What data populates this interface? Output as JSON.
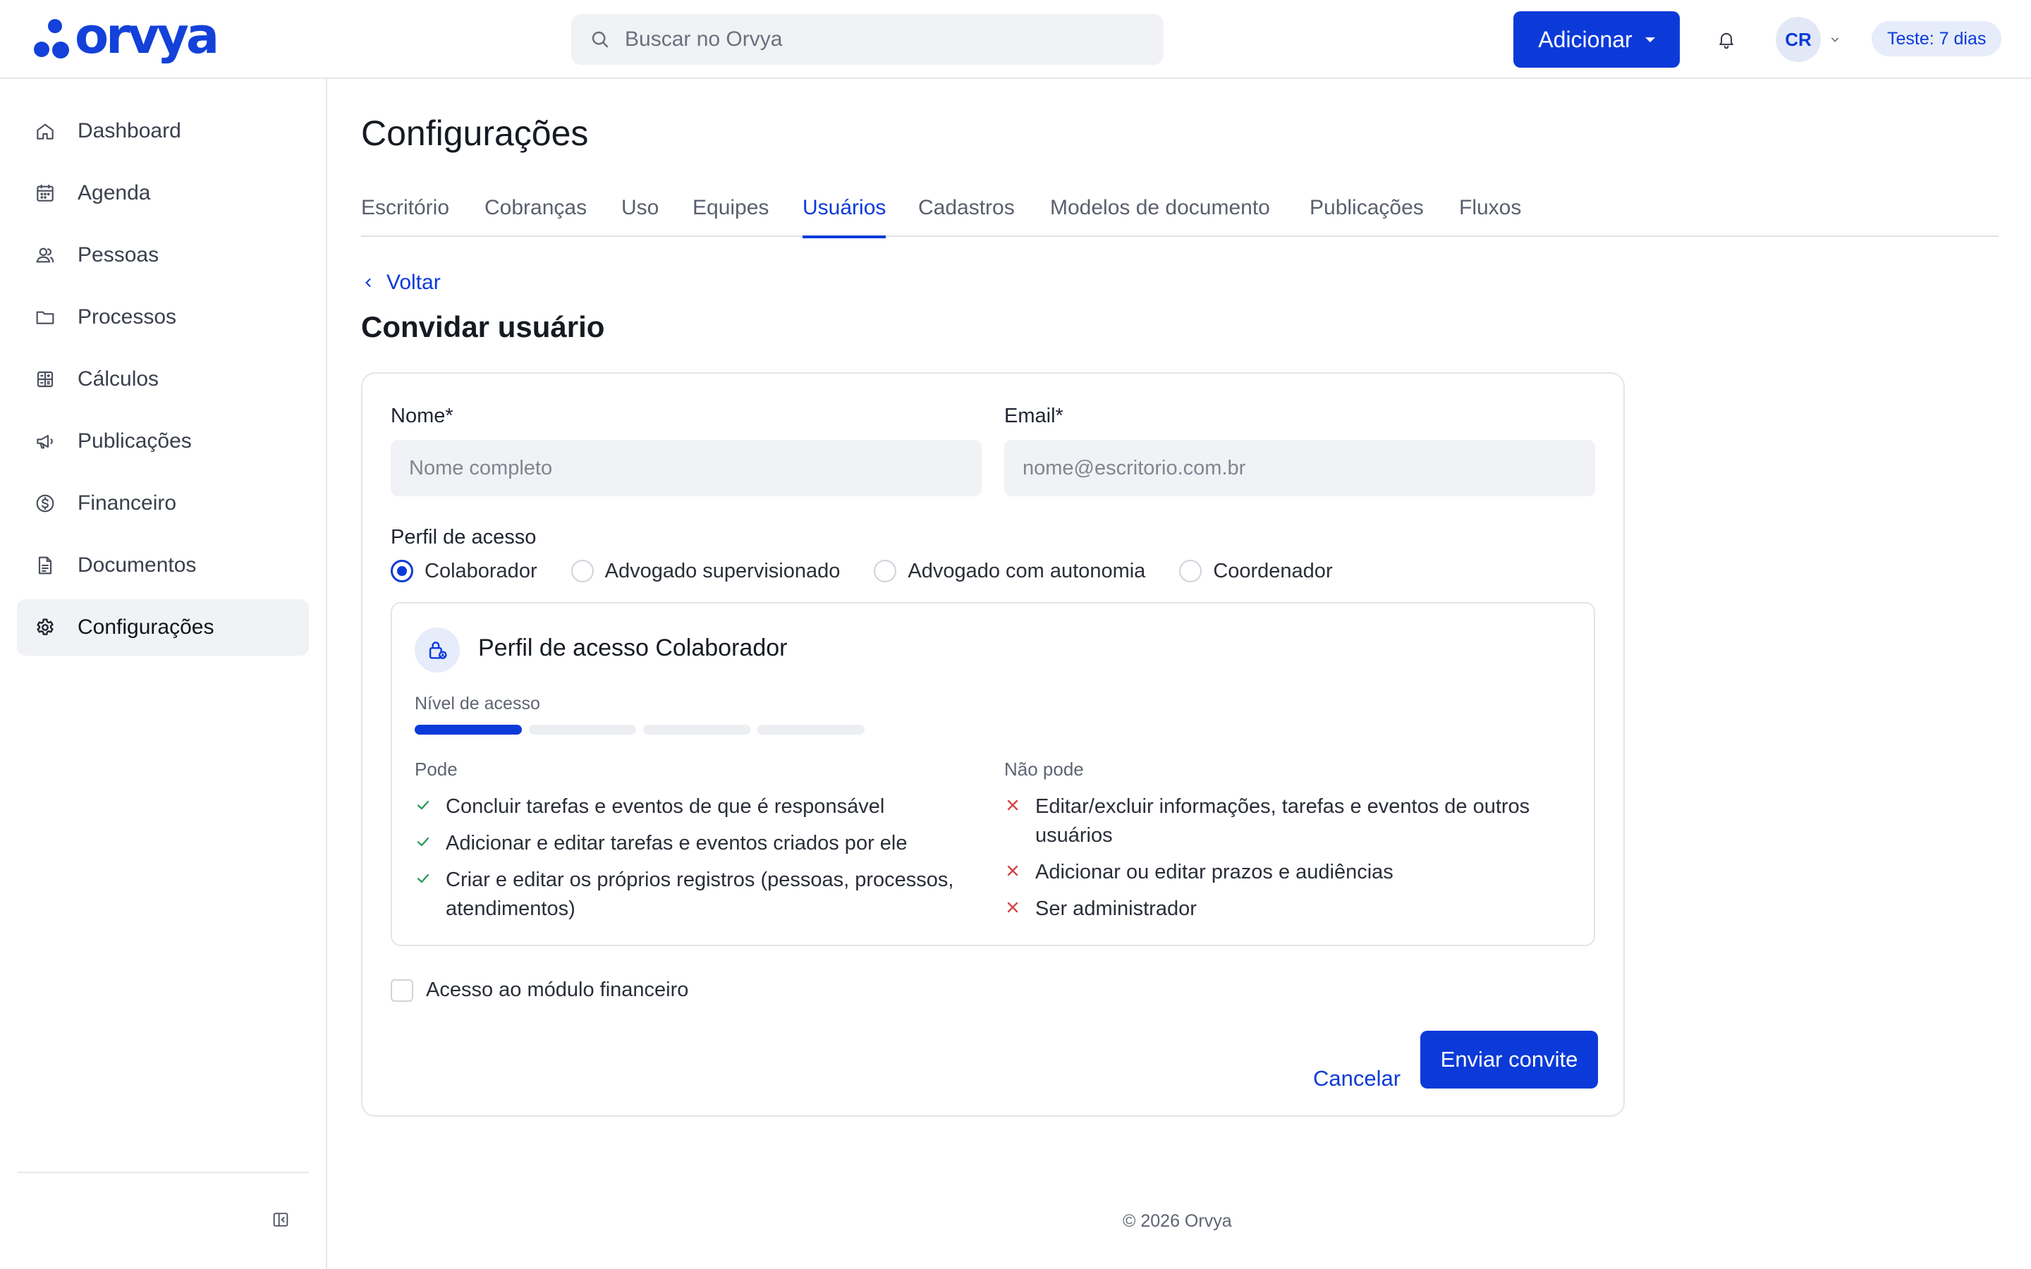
{
  "brand": {
    "name": "orvya",
    "color": "#0c3ad9"
  },
  "search": {
    "placeholder": "Buscar no Orvya",
    "value": ""
  },
  "header": {
    "add_label": "Adicionar",
    "avatar_initials": "CR",
    "trial_badge": "Teste: 7 dias"
  },
  "sidebar": {
    "items": [
      {
        "label": "Dashboard",
        "icon": "home-icon"
      },
      {
        "label": "Agenda",
        "icon": "calendar-icon"
      },
      {
        "label": "Pessoas",
        "icon": "users-icon"
      },
      {
        "label": "Processos",
        "icon": "folder-icon"
      },
      {
        "label": "Cálculos",
        "icon": "calculator-icon"
      },
      {
        "label": "Publicações",
        "icon": "megaphone-icon"
      },
      {
        "label": "Financeiro",
        "icon": "dollar-circle-icon"
      },
      {
        "label": "Documentos",
        "icon": "document-icon"
      },
      {
        "label": "Configurações",
        "icon": "gear-icon",
        "active": true
      }
    ]
  },
  "page": {
    "title": "Configurações",
    "tabs": [
      {
        "label": "Escritório"
      },
      {
        "label": "Cobranças"
      },
      {
        "label": "Uso"
      },
      {
        "label": "Equipes"
      },
      {
        "label": "Usuários",
        "active": true
      },
      {
        "label": "Cadastros"
      },
      {
        "label": "Modelos de documento"
      },
      {
        "label": "Publicações"
      },
      {
        "label": "Fluxos"
      }
    ],
    "back_label": "Voltar",
    "section_title": "Convidar usuário"
  },
  "form": {
    "name": {
      "label": "Nome*",
      "placeholder": "Nome completo",
      "value": ""
    },
    "email": {
      "label": "Email*",
      "placeholder": "nome@escritorio.com.br",
      "value": ""
    },
    "profile_label": "Perfil de acesso",
    "profiles": [
      {
        "label": "Colaborador",
        "checked": true
      },
      {
        "label": "Advogado supervisionado",
        "checked": false
      },
      {
        "label": "Advogado com autonomia",
        "checked": false
      },
      {
        "label": "Coordenador",
        "checked": false
      }
    ],
    "profile_card": {
      "title": "Perfil de acesso Colaborador",
      "level_label": "Nível de acesso",
      "level": 1,
      "level_max": 4,
      "can_title": "Pode",
      "can": [
        "Concluir tarefas e eventos de que é responsável",
        "Adicionar e editar tarefas e eventos criados por ele",
        "Criar e editar os próprios registros (pessoas, processos, atendimentos)"
      ],
      "cannot_title": "Não pode",
      "cannot": [
        "Editar/excluir informações, tarefas e eventos de outros usuários",
        "Adicionar ou editar prazos e audiências",
        "Ser administrador"
      ]
    },
    "finance_access_label": "Acesso ao módulo financeiro",
    "finance_access_checked": false,
    "cancel_label": "Cancelar",
    "submit_label": "Enviar convite"
  },
  "footer": {
    "text": "© 2026 Orvya"
  }
}
